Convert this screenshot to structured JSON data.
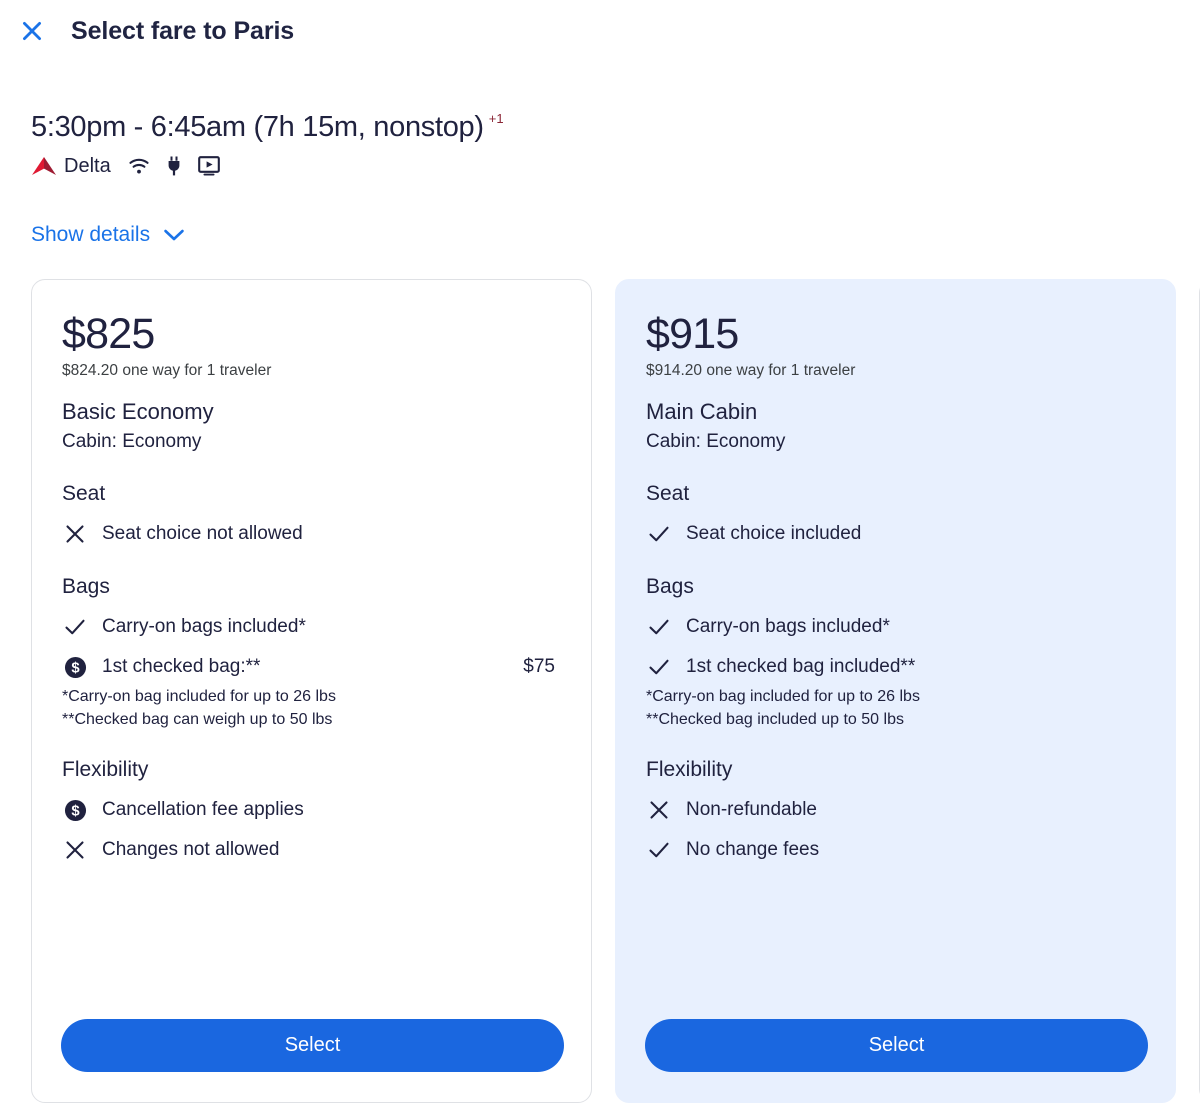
{
  "header": {
    "close_icon": "close-icon",
    "title": "Select fare to Paris"
  },
  "flight": {
    "times": "5:30pm - 6:45am (7h 15m, nonstop)",
    "plus_days": "+1",
    "airline": "Delta",
    "airline_logo_icon": "delta-logo-icon",
    "amenities": [
      "wifi-icon",
      "power-outlet-icon",
      "in-flight-video-icon"
    ],
    "show_details_label": "Show details",
    "show_details_chevron_icon": "chevron-down-icon"
  },
  "colors": {
    "accent_blue": "#1a73e8",
    "button_blue": "#1a67e0",
    "highlight_card_bg": "#e8f0fe",
    "text_dark": "#20223f",
    "delta_red": "#c8102e",
    "plus_day_red": "#8a2535"
  },
  "fares": [
    {
      "price": "$825",
      "price_sub": "$824.20 one way for 1 traveler",
      "fare_name": "Basic Economy",
      "cabin": "Cabin: Economy",
      "highlighted": false,
      "sections": [
        {
          "title": "Seat",
          "rows": [
            {
              "icon": "x-icon",
              "text": "Seat choice not allowed",
              "price": ""
            }
          ],
          "footnotes": []
        },
        {
          "title": "Bags",
          "rows": [
            {
              "icon": "check-icon",
              "text": "Carry-on bags included*",
              "price": ""
            },
            {
              "icon": "dollar-circle-icon",
              "text": "1st checked bag:**",
              "price": "$75"
            }
          ],
          "footnotes": [
            "*Carry-on bag included for up to 26 lbs",
            "**Checked bag can weigh up to 50 lbs"
          ]
        },
        {
          "title": "Flexibility",
          "rows": [
            {
              "icon": "dollar-circle-icon",
              "text": "Cancellation fee applies",
              "price": ""
            },
            {
              "icon": "x-icon",
              "text": "Changes not allowed",
              "price": ""
            }
          ],
          "footnotes": []
        }
      ],
      "select_label": "Select"
    },
    {
      "price": "$915",
      "price_sub": "$914.20 one way for 1 traveler",
      "fare_name": "Main Cabin",
      "cabin": "Cabin: Economy",
      "highlighted": true,
      "sections": [
        {
          "title": "Seat",
          "rows": [
            {
              "icon": "check-icon",
              "text": "Seat choice included",
              "price": ""
            }
          ],
          "footnotes": []
        },
        {
          "title": "Bags",
          "rows": [
            {
              "icon": "check-icon",
              "text": "Carry-on bags included*",
              "price": ""
            },
            {
              "icon": "check-icon",
              "text": "1st checked bag included**",
              "price": ""
            }
          ],
          "footnotes": [
            "*Carry-on bag included for up to 26 lbs",
            "**Checked bag included up to 50 lbs"
          ]
        },
        {
          "title": "Flexibility",
          "rows": [
            {
              "icon": "x-icon",
              "text": "Non-refundable",
              "price": ""
            },
            {
              "icon": "check-icon",
              "text": "No change fees",
              "price": ""
            }
          ],
          "footnotes": []
        }
      ],
      "select_label": "Select"
    }
  ]
}
